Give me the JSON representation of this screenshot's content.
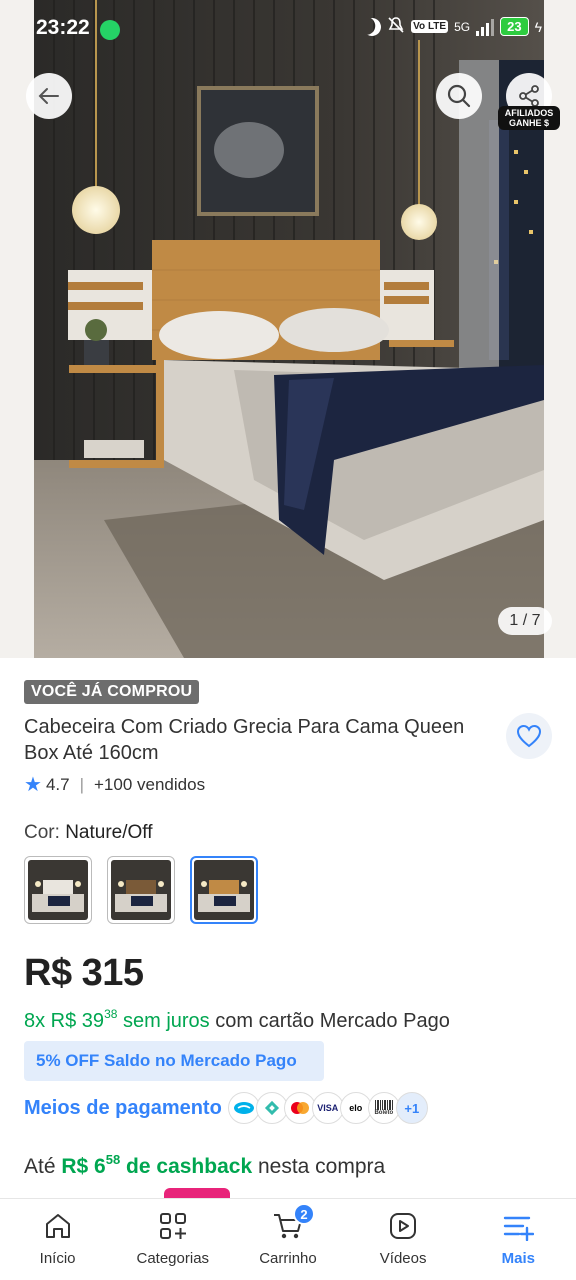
{
  "status_bar": {
    "time": "23:22",
    "network": "5G",
    "volte": "Vo LTE",
    "battery": "23"
  },
  "gallery": {
    "counter": "1 / 7"
  },
  "header_actions": {
    "afiliados_label": "AFILIADOS GANHE $"
  },
  "product": {
    "purchased_tag": "VOCÊ JÁ COMPROU",
    "title": "Cabeceira Com Criado Grecia Para Cama Queen Box Até 160cm",
    "rating": "4.7",
    "sold": "+100 vendidos",
    "color_label": "Cor:",
    "color_value": "Nature/Off",
    "swatches": [
      "Nature/Off variant 1",
      "Nature/Off variant 2",
      "Nature/Off variant 3"
    ],
    "selected_swatch": 2
  },
  "pricing": {
    "price": "R$ 315",
    "installments_prefix": "8x R$ 39",
    "installments_cents": "38",
    "installments_interest": "sem juros",
    "installments_suffix": "com cartão Mercado Pago",
    "promo": "5% OFF Saldo no Mercado Pago",
    "payment_link": "Meios de pagamento",
    "payment_icons": [
      "mercado-pago",
      "pix",
      "mastercard",
      "VISA",
      "elo",
      "Boleto"
    ],
    "payment_more": "+1",
    "cashback_prefix": "Até",
    "cashback_amount": "R$ 6",
    "cashback_cents": "58",
    "cashback_of": "de cashback",
    "cashback_suffix": "nesta compra"
  },
  "nav": {
    "items": [
      {
        "label": "Início",
        "icon": "home-icon"
      },
      {
        "label": "Categorias",
        "icon": "categories-icon"
      },
      {
        "label": "Carrinho",
        "icon": "cart-icon",
        "badge": "2"
      },
      {
        "label": "Vídeos",
        "icon": "video-icon"
      },
      {
        "label": "Mais",
        "icon": "menu-icon",
        "active": true
      }
    ]
  },
  "colors": {
    "accent": "#3483fa",
    "green": "#00a650",
    "tag_bg": "#6d6d6d",
    "promo_bg": "#e3edfb"
  }
}
